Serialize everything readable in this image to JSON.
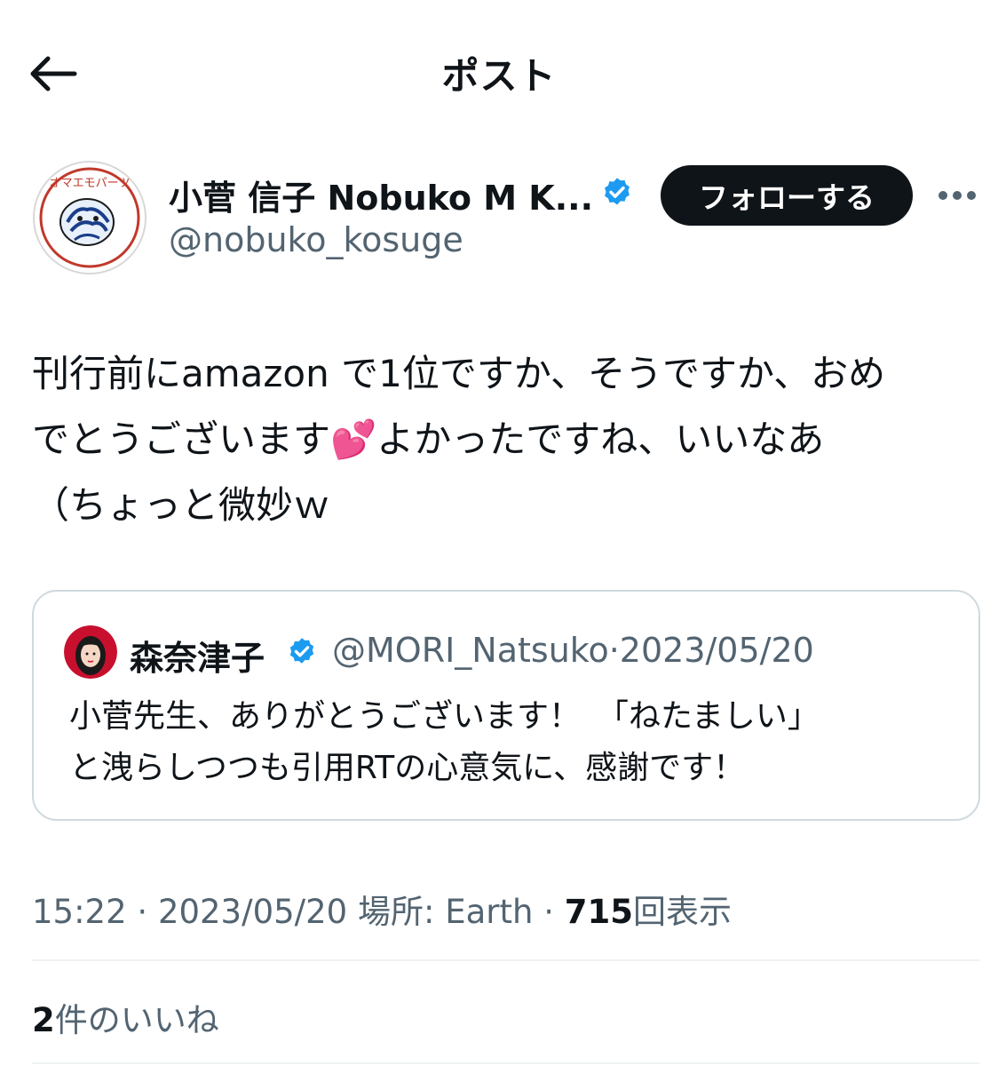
{
  "header": {
    "title": "ポスト",
    "back_icon": "arrow-left-icon"
  },
  "post": {
    "author_name": "小菅 信子 Nobuko M K...",
    "author_handle": "@nobuko_kosuge",
    "verified_icon": "verified-badge-icon",
    "follow_label": "フォローする",
    "more_icon": "more-horizontal-icon",
    "text": "刊行前にamazon で1位ですか、そうですか、おめ\nでとうございます💕よかったですね、いいなあ\n（ちょっと微妙ｗ",
    "avatar_text": "オマエモパーツ"
  },
  "quote": {
    "author_name": "森奈津子",
    "author_handle": "@MORI_Natsuko",
    "separator": "·",
    "date": "2023/05/20",
    "text": "小菅先生、ありがとうございます！　「ねたましい」\nと洩らしつつも引用RTの心意気に、感謝です！"
  },
  "meta": {
    "time": "15:22",
    "separator": "·",
    "date": "2023/05/20",
    "location": "場所: Earth",
    "views_count": "715",
    "views_label": "回表示"
  },
  "likes": {
    "count": "2",
    "label": "件のいいね"
  },
  "colors": {
    "text": "#0f1419",
    "secondary": "#536471",
    "verified": "#1d9bf0",
    "border": "#cfd9de",
    "divider": "#eff3f4"
  }
}
